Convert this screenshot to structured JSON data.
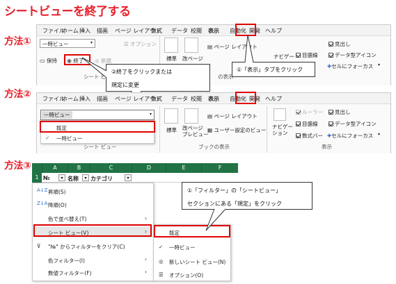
{
  "title": "シートビューを終了する",
  "methods": {
    "m1": "方法①",
    "m2": "方法②",
    "m3": "方法③"
  },
  "ribbon_tabs": [
    "ファイル",
    "ホーム",
    "挿入",
    "描画",
    "ページ レイアウト",
    "数式",
    "データ",
    "校閲",
    "表示",
    "自動化",
    "開発",
    "ヘルプ"
  ],
  "ribbon1": {
    "sheet_view_value": "一時ビュー",
    "keep": "保持",
    "exit": "終了",
    "new": "新規",
    "options": "オプション",
    "group_label": "シート ビュー",
    "normal": "標準",
    "page_break": "改ページ",
    "page_layout": "ページ レイアウト",
    "display_group": "の表示",
    "navigator": "ナビゲー",
    "gridlines": "目盛線",
    "headings": "見出し",
    "data_type_icon": "データ型アイコン",
    "cell_focus": "セルにフォーカス"
  },
  "ribbon2": {
    "sheet_view_value": "一時ビュー",
    "default_option": "既定",
    "temp_view_option": "一時ビュー",
    "group_label": "シート ビュー",
    "normal": "標準",
    "page_break": "改ページ\nプレビュー",
    "page_layout": "ページ レイアウト",
    "custom_view": "ユーザー設定のビュー",
    "book_display": "ブックの表示",
    "navigator": "ナビゲー\nション",
    "ruler": "ルーラー",
    "gridlines": "目盛線",
    "formula_bar": "数式バー",
    "headings": "見出し",
    "data_type_icon": "データ型アイコン",
    "cell_focus": "セルにフォーカス",
    "display_group": "表示"
  },
  "callouts": {
    "c1": "①「表示」タブをクリック",
    "c2_line1": "②終了をクリックまたは",
    "c2_line2": "規定に変更",
    "c3_line1": "①「フィルター」の「シートビュー」",
    "c3_line2": "セクションにある「規定」をクリック"
  },
  "sheet": {
    "columns": [
      "A",
      "B",
      "C",
      "D",
      "E",
      "F"
    ],
    "row_number": "1",
    "cells": [
      "№",
      "名称",
      "カテゴリ"
    ]
  },
  "filter_menu": {
    "sort_asc": "昇順(S)",
    "sort_desc": "降順(O)",
    "sort_color": "色で並べ替え(T)",
    "sheet_view": "シート ビュー(V)",
    "clear_filter": "\"№\" からフィルターをクリア(C)",
    "color_filter": "色フィルター(I)",
    "number_filter": "数値フィルター(F)"
  },
  "submenu": {
    "default": "既定",
    "temp_view": "一時ビュー",
    "new_sheet_view": "新しいシート ビュー(N)",
    "options": "オプション(O)"
  },
  "colors": {
    "accent_red": "#e8202a",
    "highlight_red": "#e00000",
    "excel_green": "#217346"
  }
}
